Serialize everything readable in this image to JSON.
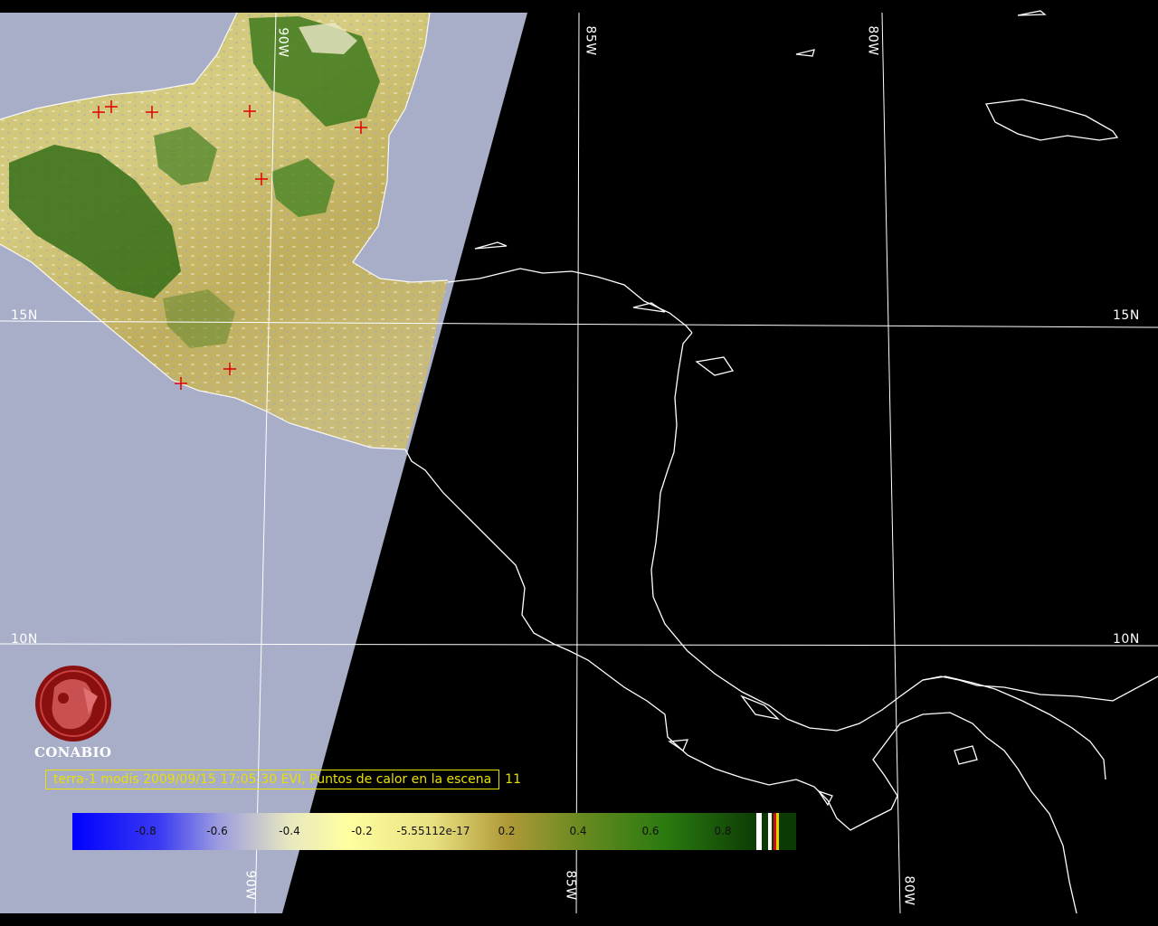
{
  "title_caption": {
    "text": "terra-1 modis 2009/09/15 17:05:30 EVI, Puntos de calor en la escena",
    "count": "11"
  },
  "logo": {
    "name": "CONABIO"
  },
  "grid_labels": {
    "lat_15_left": "15N",
    "lat_15_right": "15N",
    "lat_10_left": "10N",
    "lat_10_right": "10N",
    "lon_90_top": "90W",
    "lon_85_top": "85W",
    "lon_80_top": "80W",
    "lon_90_bottom": "90W",
    "lon_85_bottom": "85W",
    "lon_80_bottom": "80W"
  },
  "colorbar": {
    "ticks": [
      "-0.8",
      "-0.6",
      "-0.4",
      "-0.2",
      "-5.55112e-17",
      "0.2",
      "0.4",
      "0.6",
      "0.8"
    ],
    "colors": {
      "blue": "#0000ff",
      "light": "#ffffa0",
      "gold": "#a08a2a",
      "green": "#2a7a10",
      "dark_green": "#0c3a05"
    }
  },
  "hotspots_count": 11,
  "colors": {
    "no_data": "#a8adc8",
    "background": "#000000",
    "grid_lines": "#ffffff",
    "hotspot_marker": "#e00000",
    "caption": "#e8e000",
    "logo": "#8a1010"
  }
}
